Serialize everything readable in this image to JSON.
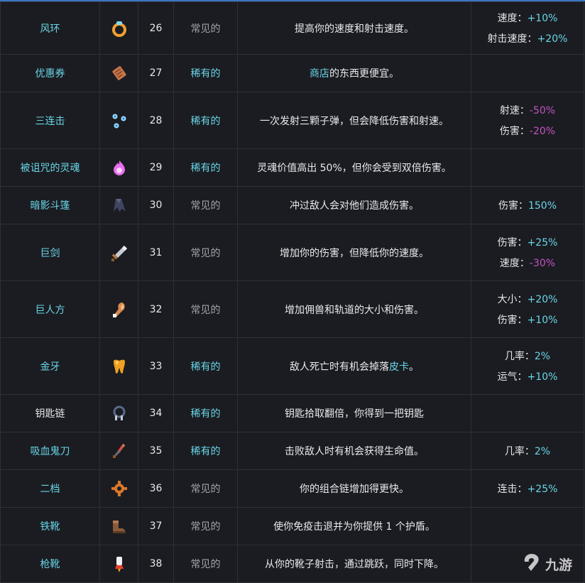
{
  "colors": {
    "accent": "#67d6e8",
    "negative": "#c254c2",
    "common": "#a2a4ad",
    "background": "#1b1c21"
  },
  "rows": [
    {
      "name": "风环",
      "id": "26",
      "rarity": "常见的",
      "desc": "提高你的速度和射击速度。",
      "icon": "wind-ring-icon",
      "stats": [
        {
          "label": "速度：",
          "value": "+10%"
        },
        {
          "label": "射击速度：",
          "value": "+20%"
        }
      ]
    },
    {
      "name": "优惠券",
      "id": "27",
      "rarity": "稀有的",
      "desc_pre": "商店",
      "desc_post": "的东西更便宜。",
      "icon": "coupon-icon",
      "stats": []
    },
    {
      "name": "三连击",
      "id": "28",
      "rarity": "稀有的",
      "desc": "一次发射三颗子弹，但会降低伤害和射速。",
      "icon": "triple-shot-icon",
      "stats": [
        {
          "label": "射速：",
          "value": "-50%"
        },
        {
          "label": "伤害：",
          "value": "-20%"
        }
      ]
    },
    {
      "name": "被诅咒的灵魂",
      "id": "29",
      "rarity": "稀有的",
      "desc": "灵魂价值高出 50%，但你会受到双倍伤害。",
      "icon": "cursed-soul-icon",
      "stats": []
    },
    {
      "name": "暗影斗篷",
      "id": "30",
      "rarity": "常见的",
      "desc": "冲过敌人会对他们造成伤害。",
      "icon": "shadow-cloak-icon",
      "stats": [
        {
          "label": "伤害：",
          "value": "150%"
        }
      ]
    },
    {
      "name": "巨剑",
      "id": "31",
      "rarity": "常见的",
      "desc": "增加你的伤害，但降低你的速度。",
      "icon": "greatsword-icon",
      "stats": [
        {
          "label": "伤害：",
          "value": "+25%"
        },
        {
          "label": "速度：",
          "value": "-30%"
        }
      ]
    },
    {
      "name": "巨人方",
      "id": "32",
      "rarity": "常见的",
      "desc": "增加佣兽和轨道的大小和伤害。",
      "icon": "giant-formula-icon",
      "stats": [
        {
          "label": "大小：",
          "value": "+20%"
        },
        {
          "label": "伤害：",
          "value": "+10%"
        }
      ]
    },
    {
      "name": "金牙",
      "id": "33",
      "rarity": "稀有的",
      "desc_pre": "敌人死亡时有机会掉落",
      "desc_hl": "皮卡",
      "desc_post": "。",
      "icon": "gold-tooth-icon",
      "stats": [
        {
          "label": "几率：",
          "value": "2%"
        },
        {
          "label": "运气：",
          "value": "+10%"
        }
      ]
    },
    {
      "name": "钥匙链",
      "id": "34",
      "rarity": "稀有的",
      "desc": "钥匙拾取翻倍，你得到一把钥匙",
      "icon": "keychain-icon",
      "stats": []
    },
    {
      "name": "吸血鬼刀",
      "id": "35",
      "rarity": "稀有的",
      "desc": "击败敌人时有机会获得生命值。",
      "icon": "vampire-knife-icon",
      "stats": [
        {
          "label": "几率：",
          "value": "2%"
        }
      ]
    },
    {
      "name": "二档",
      "id": "36",
      "rarity": "常见的",
      "desc": "你的组合链增加得更快。",
      "icon": "second-gear-icon",
      "stats": [
        {
          "label": "连击：",
          "value": "+25%"
        }
      ]
    },
    {
      "name": "铁靴",
      "id": "37",
      "rarity": "常见的",
      "desc": "使你免疫击退并为你提供 1 个护盾。",
      "icon": "iron-boots-icon",
      "stats": []
    },
    {
      "name": "枪靴",
      "id": "38",
      "rarity": "常见的",
      "desc": "从你的靴子射击，通过跳跃，同时下降。",
      "icon": "gun-boots-icon",
      "stats": []
    }
  ],
  "watermark": {
    "text": "九游",
    "icon": "jiuyou-logo-icon"
  }
}
